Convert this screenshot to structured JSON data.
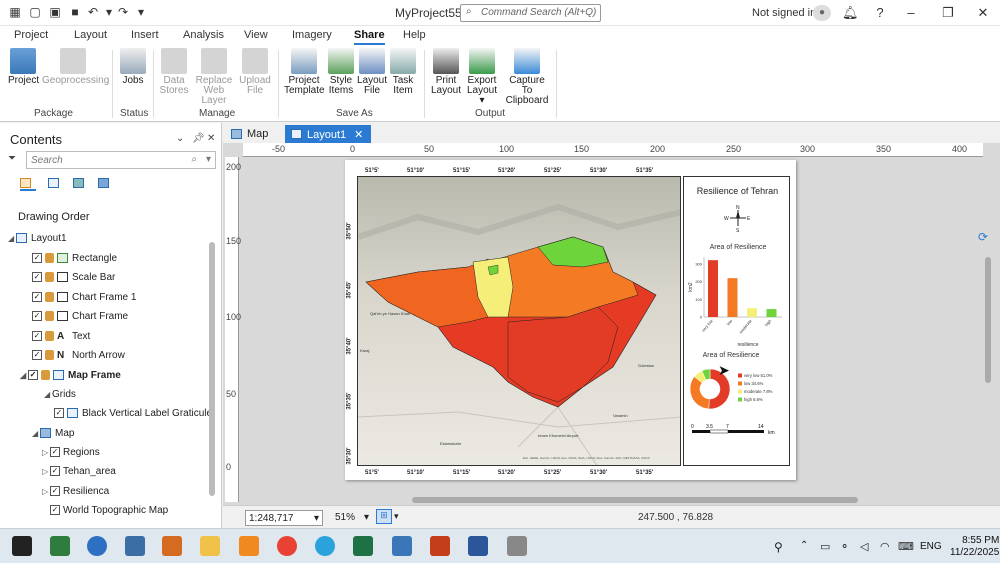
{
  "window": {
    "title": "MyProject55",
    "search_placeholder": "Command Search (Alt+Q)",
    "signed_in": "Not signed in"
  },
  "ribbon_tabs": [
    "Project",
    "Layout",
    "Insert",
    "Analysis",
    "View",
    "Imagery",
    "Share",
    "Help"
  ],
  "active_tab": "Share",
  "ribbon": {
    "package": {
      "label": "Package",
      "project": "Project",
      "geoprocessing": "Geoprocessing"
    },
    "status": {
      "label": "Status",
      "jobs": "Jobs"
    },
    "manage": {
      "label": "Manage",
      "data_stores": [
        "Data",
        "Stores"
      ],
      "replace_web_layer": [
        "Replace",
        "Web Layer"
      ],
      "upload_file": [
        "Upload",
        "File"
      ]
    },
    "save_as": {
      "label": "Save As",
      "project_template": [
        "Project",
        "Template"
      ],
      "style_items": [
        "Style",
        "Items"
      ],
      "layout_file": [
        "Layout",
        "File"
      ],
      "task_item": [
        "Task",
        "Item"
      ]
    },
    "output": {
      "label": "Output",
      "print_layout": [
        "Print",
        "Layout"
      ],
      "export_layout": [
        "Export",
        "Layout ▾"
      ],
      "capture": [
        "Capture To",
        "Clipboard"
      ]
    }
  },
  "contents": {
    "title": "Contents",
    "search_placeholder": "Search",
    "drawing_order": "Drawing Order",
    "items": {
      "layout1": "Layout1",
      "rectangle": "Rectangle",
      "scale_bar": "Scale Bar",
      "chart_frame_1": "Chart Frame 1",
      "chart_frame": "Chart Frame",
      "text": "Text",
      "north_arrow": "North Arrow",
      "map_frame": "Map Frame",
      "grids": "Grids",
      "graticule": "Black Vertical Label Graticule",
      "map": "Map",
      "regions": "Regions",
      "tehan_area": "Tehan_area",
      "resilienca": "Resilienca",
      "world_topo": "World Topographic Map"
    }
  },
  "view_tabs": {
    "map": "Map",
    "layout": "Layout1"
  },
  "rulers": {
    "h": [
      "-50",
      "0",
      "50",
      "100",
      "150",
      "200",
      "250",
      "300",
      "350",
      "400"
    ],
    "v": [
      "200",
      "150",
      "100",
      "50",
      "0"
    ]
  },
  "layout": {
    "legend_title": "Resilience of Tehran",
    "north": {
      "n": "N",
      "s": "S",
      "e": "E",
      "w": "W"
    },
    "graticule_top": [
      "51°5'",
      "51°10'",
      "51°15'",
      "51°20'",
      "51°25'",
      "51°30'",
      "51°35'"
    ],
    "graticule_left": [
      "35°50'",
      "35°45'",
      "35°40'",
      "35°35'",
      "35°30'"
    ],
    "attribution": "Esri, HERE, Garmin, USGS, Esri, NASA, NGA, USGS | Esri, Garmin, FAO, METI/NASA, USGS",
    "place_labels": [
      "Qal'eh-ye Hasan Khan",
      "Karaj",
      "Eslamshahr",
      "Imam Khomeini Airport",
      "Golestan",
      "Varamin"
    ]
  },
  "chart_data": [
    {
      "type": "bar",
      "title": "Area of Resilience",
      "categories": [
        "very low",
        "low",
        "moderate",
        "high"
      ],
      "values": [
        322,
        220,
        50,
        45
      ],
      "ylabel": "km2",
      "xlabel": "resilience",
      "yticks": [
        "0",
        "100",
        "200",
        "300"
      ],
      "ylim": [
        0,
        340
      ],
      "colors": [
        "#e23b26",
        "#f47a24",
        "#f5ef7a",
        "#6ed43c"
      ]
    },
    {
      "type": "pie",
      "title": "Area of Resilience",
      "labels": [
        "very low 51.0%",
        "low 34.6%",
        "moderate 7.8%",
        "high 6.6%"
      ],
      "values": [
        51.0,
        34.6,
        7.8,
        6.6
      ],
      "colors": [
        "#e23b26",
        "#f47a24",
        "#f5ef7a",
        "#6ed43c"
      ]
    }
  ],
  "scalebar": {
    "labels": [
      "0",
      "3.5",
      "7",
      "14"
    ],
    "unit": "km"
  },
  "status": {
    "scale": "1:248,717",
    "zoom": "51%",
    "coords": "247.500 , 76.828"
  },
  "taskbar": {
    "time": "8:55 PM",
    "date": "11/22/2025",
    "lang": "ENG"
  }
}
